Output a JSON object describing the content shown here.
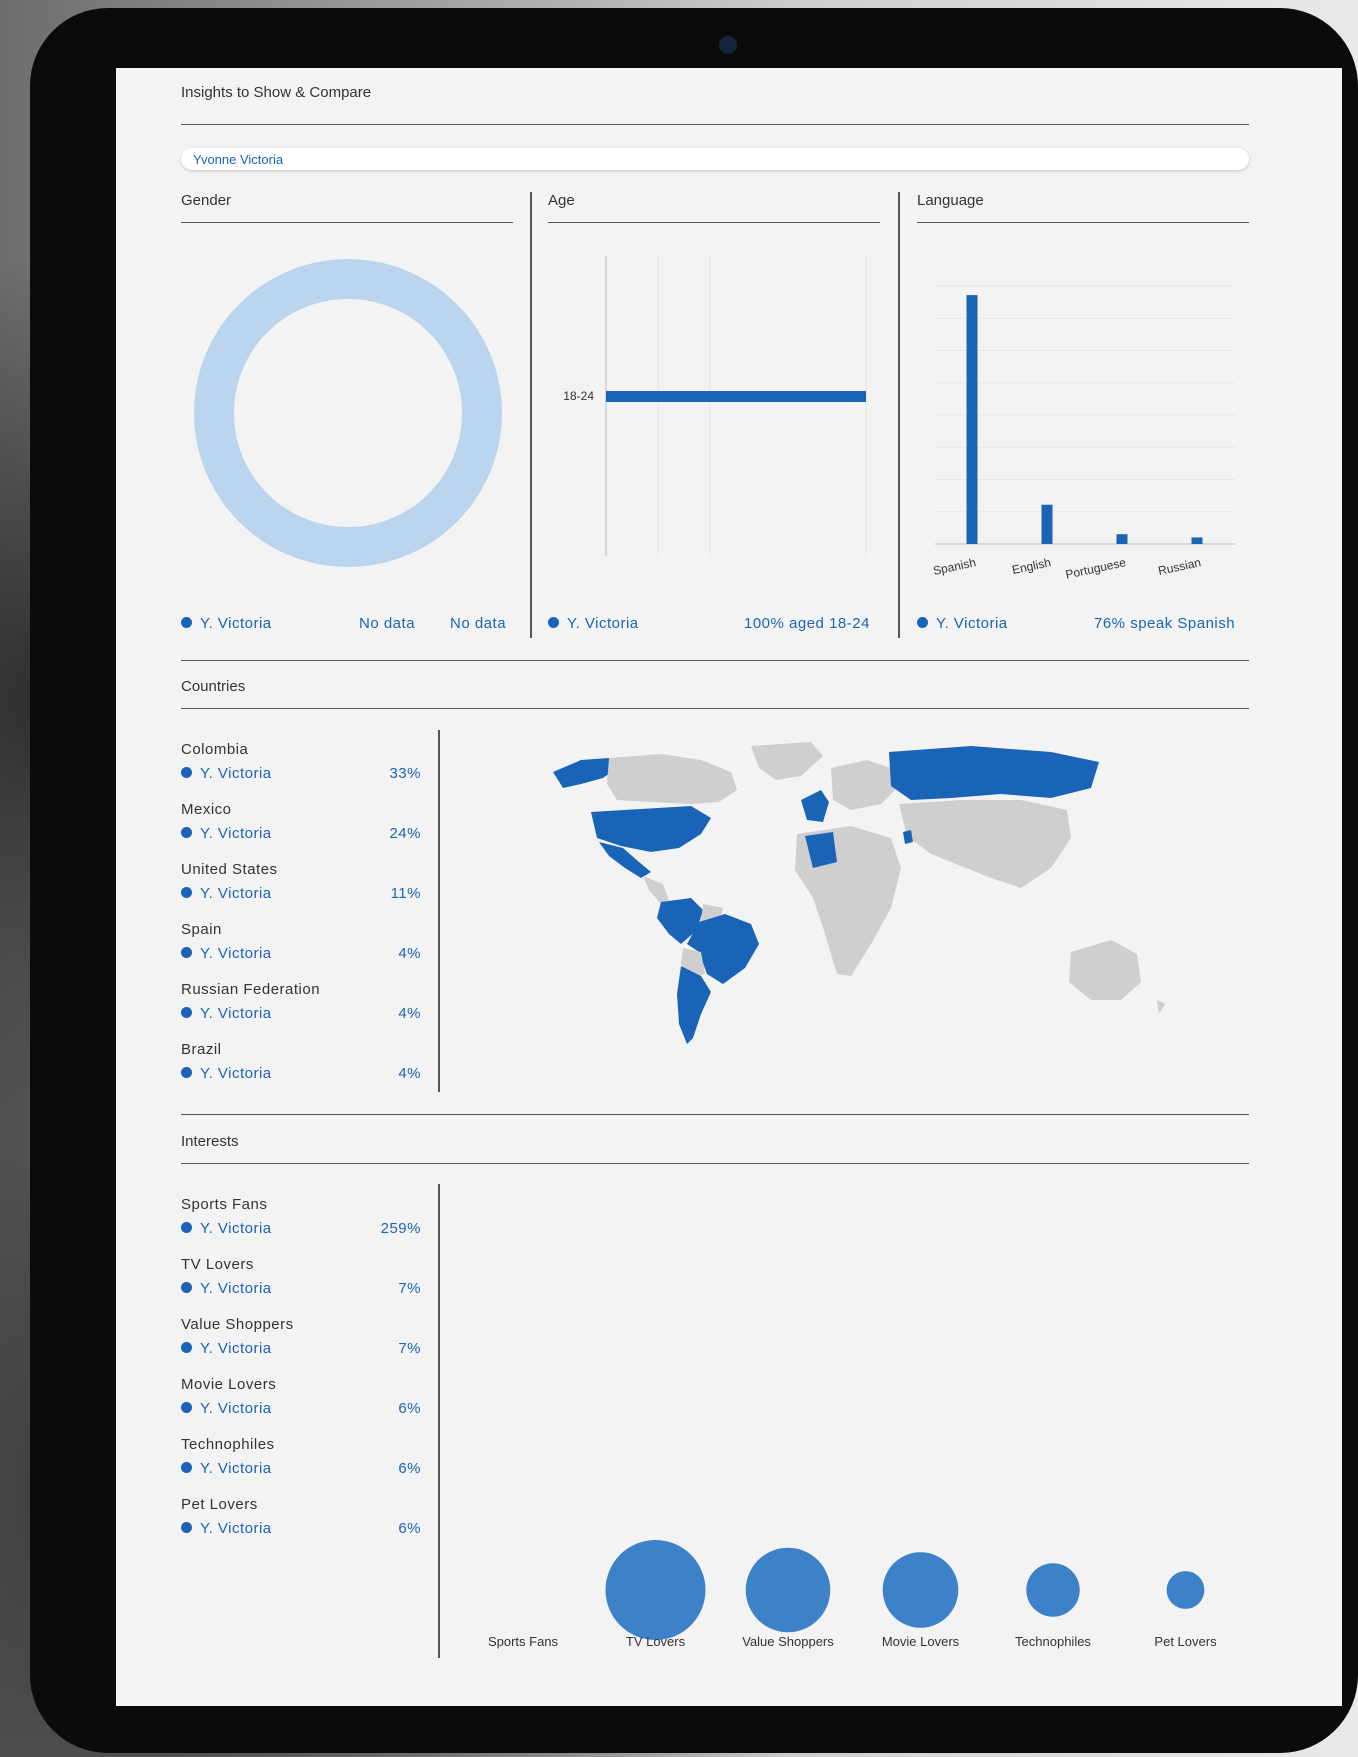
{
  "header": {
    "title": "Insights to Show & Compare",
    "selected_profile": "Yvonne Victoria"
  },
  "colors": {
    "accent": "#1a64b8",
    "donut": "#bcd5ee",
    "map_inactive": "#cfcfcf",
    "bubble": "#3d82c8"
  },
  "gender": {
    "title": "Gender",
    "legend": "Y. Victoria",
    "value1": "No data",
    "value2": "No data"
  },
  "age": {
    "title": "Age",
    "legend": "Y. Victoria",
    "summary": "100% aged 18-24"
  },
  "language": {
    "title": "Language",
    "legend": "Y. Victoria",
    "summary": "76% speak Spanish"
  },
  "countries": {
    "title": "Countries",
    "items": [
      {
        "name": "Colombia",
        "series": "Y. Victoria",
        "pct": "33%"
      },
      {
        "name": "Mexico",
        "series": "Y. Victoria",
        "pct": "24%"
      },
      {
        "name": "United States",
        "series": "Y. Victoria",
        "pct": "11%"
      },
      {
        "name": "Spain",
        "series": "Y. Victoria",
        "pct": "4%"
      },
      {
        "name": "Russian Federation",
        "series": "Y. Victoria",
        "pct": "4%"
      },
      {
        "name": "Brazil",
        "series": "Y. Victoria",
        "pct": "4%"
      }
    ]
  },
  "interests": {
    "title": "Interests",
    "items": [
      {
        "name": "Sports Fans",
        "series": "Y. Victoria",
        "pct": "259%"
      },
      {
        "name": "TV Lovers",
        "series": "Y. Victoria",
        "pct": "7%"
      },
      {
        "name": "Value Shoppers",
        "series": "Y. Victoria",
        "pct": "7%"
      },
      {
        "name": "Movie Lovers",
        "series": "Y. Victoria",
        "pct": "6%"
      },
      {
        "name": "Technophiles",
        "series": "Y. Victoria",
        "pct": "6%"
      },
      {
        "name": "Pet Lovers",
        "series": "Y. Victoria",
        "pct": "6%"
      }
    ]
  },
  "chart_data": [
    {
      "type": "pie",
      "title": "Gender",
      "categories": [],
      "values": []
    },
    {
      "type": "bar",
      "title": "Age",
      "orientation": "horizontal",
      "categories": [
        "18-24"
      ],
      "values": [
        100
      ],
      "xlim": [
        0,
        100
      ]
    },
    {
      "type": "bar",
      "title": "Language",
      "categories": [
        "Spanish",
        "English",
        "Portuguese",
        "Russian"
      ],
      "values": [
        76,
        12,
        3,
        2
      ],
      "ylim": [
        0,
        80
      ]
    },
    {
      "type": "scatter",
      "subtype": "bubble",
      "title": "Interests",
      "categories": [
        "Sports Fans",
        "TV Lovers",
        "Value Shoppers",
        "Movie Lovers",
        "Technophiles",
        "Pet Lovers"
      ],
      "values": [
        0,
        7,
        5,
        4,
        2,
        1
      ]
    }
  ]
}
